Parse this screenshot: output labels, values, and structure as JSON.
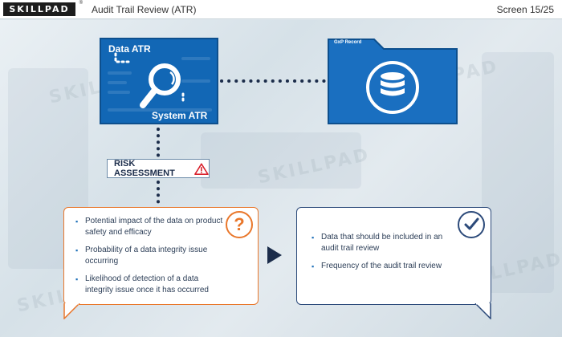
{
  "header": {
    "logo_text": "SKILLPAD",
    "logo_mark": "®",
    "title": "Audit Trail Review (ATR)",
    "screen_counter": "Screen 15/25"
  },
  "diagram": {
    "data_atr_label": "Data ATR",
    "system_atr_label": "System ATR",
    "gxp_record_label": "GxP Record",
    "risk_assessment_label": "RISK ASSESSMENT",
    "icons": [
      "magnifier-icon",
      "database-icon",
      "warning-icon",
      "question-icon",
      "checkmark-icon",
      "play-arrow-icon"
    ]
  },
  "risk_factors": {
    "items": [
      "Potential impact of the data on product safety and efficacy",
      "Probability of a data integrity issue occurring",
      "Likelihood of detection of a data integrity issue once it has occurred"
    ]
  },
  "outcomes": {
    "items": [
      "Data that should be included in an audit trail review",
      "Frequency of the audit trail review"
    ]
  },
  "colors": {
    "accent_orange": "#e9772b",
    "navy": "#2c4a7a",
    "atr_blue": "#1267b5",
    "folder_blue": "#1a6fc0"
  }
}
